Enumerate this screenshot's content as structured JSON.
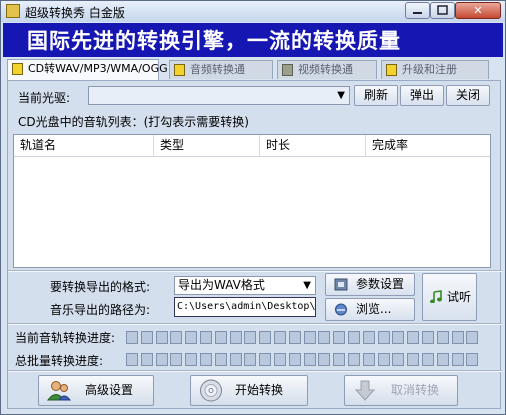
{
  "window": {
    "title": "超级转换秀 白金版",
    "controls": [
      "minimize",
      "maximize",
      "close"
    ],
    "close_glyph": "✕"
  },
  "banner": {
    "text": "国际先进的转换引擎，一流的转换质量"
  },
  "tabs": [
    {
      "label": "CD转WAV/MP3/WMA/OGG",
      "icon": "cd-tab-icon",
      "active": true
    },
    {
      "label": "音频转换通",
      "icon": "audio-tab-icon",
      "active": false
    },
    {
      "label": "视频转换通",
      "icon": "video-tab-icon",
      "active": false
    },
    {
      "label": "升级和注册",
      "icon": "folder-tab-icon",
      "active": false
    }
  ],
  "drive": {
    "label": "当前光驱:",
    "selected": "",
    "buttons": {
      "refresh": "刷新",
      "eject": "弹出",
      "close": "关闭"
    }
  },
  "tracklist": {
    "caption": "CD光盘中的音轨列表：(打勾表示需要转换)",
    "columns": [
      "轨道名",
      "类型",
      "时长",
      "完成率"
    ],
    "rows": []
  },
  "output": {
    "format_label": "要转换导出的格式:",
    "format_value": "导出为WAV格式",
    "path_label": "音乐导出的路径为:",
    "path_value": "C:\\Users\\admin\\Desktop\\",
    "params_button": "参数设置",
    "browse_button": "浏览...",
    "listen_button": "试听"
  },
  "progress": {
    "current_label": "当前音轨转换进度:",
    "total_label": "总批量转换进度:",
    "current": 0,
    "total": 0,
    "segments": 24
  },
  "actions": {
    "advanced": "高级设置",
    "start": "开始转换",
    "cancel": "取消转换",
    "cancel_enabled": false
  },
  "colors": {
    "banner_bg": "#1616b3",
    "banner_text": "#ffffff",
    "panel_bg": "#d4dfee",
    "close_button": "#c44a32"
  }
}
